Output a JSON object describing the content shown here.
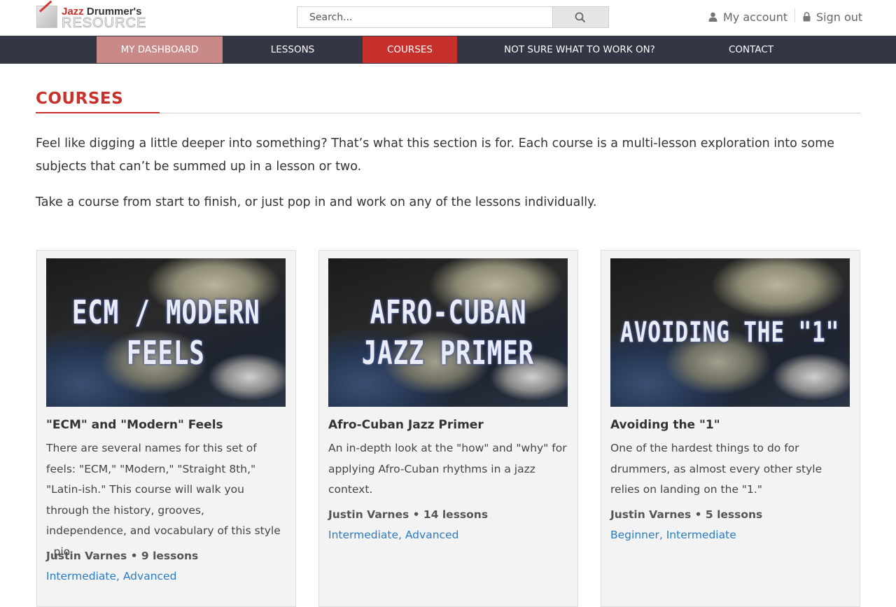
{
  "header": {
    "logo": {
      "line1_accent": "Jazz",
      "line1_rest": " Drummer's",
      "line2": "RESOURCE"
    },
    "search": {
      "placeholder": "Search..."
    },
    "account": {
      "my_account": "My account",
      "sign_out": "Sign out"
    }
  },
  "nav": {
    "items": [
      {
        "label": "MY DASHBOARD"
      },
      {
        "label": "LESSONS"
      },
      {
        "label": "COURSES"
      },
      {
        "label": "NOT SURE WHAT TO WORK ON?"
      },
      {
        "label": "CONTACT"
      }
    ],
    "active": "COURSES"
  },
  "page": {
    "title": "COURSES",
    "intro_1": "Feel like digging a little deeper into something? That’s what this section is for. Each course is a multi-lesson exploration into some subjects that can’t be summed up in a lesson or two.",
    "intro_2": "Take a course from start to finish, or just pop in and work on any of the lessons individually."
  },
  "courses": [
    {
      "thumb_line1": "ECM / MODERN",
      "thumb_line2": "FEELS",
      "title": "\"ECM\" and \"Modern\" Feels",
      "description": "There are several names for this set of feels: \"ECM,\" \"Modern,\" \"Straight 8th,\" \"Latin-ish.\" This course will walk you through the history, grooves, independence, and vocabulary of this style - pio...",
      "meta": "Justin Varnes • 9 lessons",
      "tags": "Intermediate, Advanced"
    },
    {
      "thumb_line1": "AFRO-CUBAN",
      "thumb_line2": "JAZZ PRIMER",
      "title": "Afro-Cuban Jazz Primer",
      "description": "An in-depth look at the \"how\" and \"why\" for applying Afro-Cuban rhythms in a jazz context.",
      "meta": "Justin Varnes • 14 lessons",
      "tags": "Intermediate, Advanced"
    },
    {
      "thumb_line1": "AVOIDING THE \"1\"",
      "title": "Avoiding the \"1\"",
      "description": "One of the hardest things to do for drummers, as almost every other style relies on landing on the \"1.\"",
      "meta": "Justin Varnes • 5 lessons",
      "tags": "Beginner, Intermediate"
    }
  ],
  "colors": {
    "brand_red": "#c8302c",
    "nav_bg": "#333745",
    "dashboard_bg": "#c98a87",
    "link_blue": "#2a7bc4"
  }
}
